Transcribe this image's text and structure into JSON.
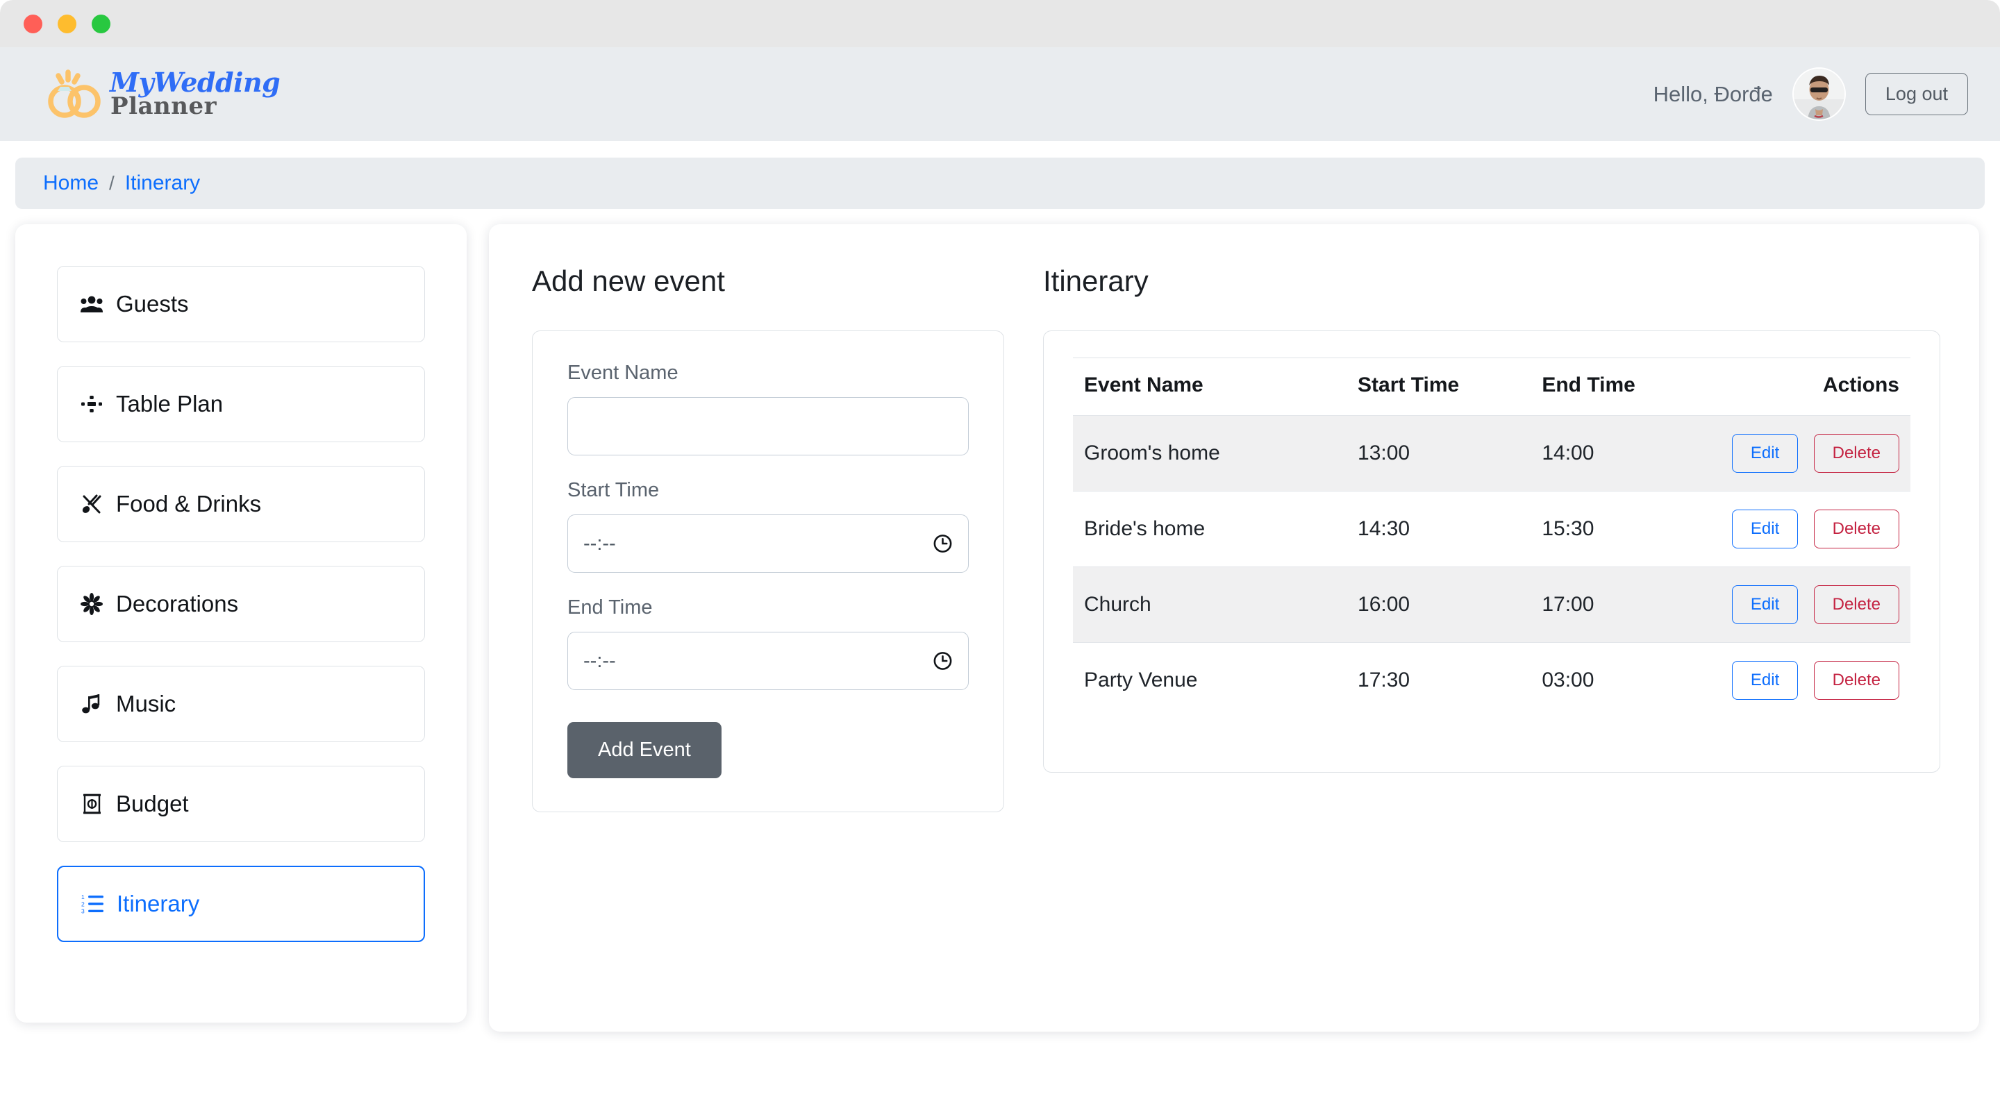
{
  "window_controls": {
    "close": "close",
    "minimize": "minimize",
    "maximize": "maximize"
  },
  "brand": {
    "line1": "MyWedding",
    "line2": "Planner",
    "icon": "wedding-rings-icon",
    "color_primary": "#2f6df6",
    "color_secondary": "#58595b",
    "ring_color": "#fcc36a"
  },
  "header": {
    "greeting": "Hello, Đorđe",
    "avatar_alt": "user-avatar",
    "logout_label": "Log out"
  },
  "breadcrumb": {
    "items": [
      {
        "label": "Home"
      },
      {
        "label": "Itinerary"
      }
    ],
    "separator": "/",
    "link_color": "#0d6efd"
  },
  "sidebar": {
    "items": [
      {
        "label": "Guests",
        "icon": "people-group-icon",
        "active": false
      },
      {
        "label": "Table Plan",
        "icon": "table-plan-icon",
        "active": false
      },
      {
        "label": "Food & Drinks",
        "icon": "fork-spoon-icon",
        "active": false
      },
      {
        "label": "Decorations",
        "icon": "flower-icon",
        "active": false
      },
      {
        "label": "Music",
        "icon": "music-note-icon",
        "active": false
      },
      {
        "label": "Budget",
        "icon": "money-receipt-icon",
        "active": false
      },
      {
        "label": "Itinerary",
        "icon": "ordered-list-icon",
        "active": true
      }
    ],
    "active_color": "#0d6efd"
  },
  "form": {
    "title": "Add new event",
    "event_name": {
      "label": "Event Name",
      "value": "",
      "placeholder": ""
    },
    "start_time": {
      "label": "Start Time",
      "value": "",
      "placeholder": "--:--",
      "icon": "clock-icon"
    },
    "end_time": {
      "label": "End Time",
      "value": "",
      "placeholder": "--:--",
      "icon": "clock-icon"
    },
    "submit_label": "Add Event",
    "submit_color": "#5a626b"
  },
  "itinerary": {
    "title": "Itinerary",
    "columns": [
      "Event Name",
      "Start Time",
      "End Time",
      "Actions"
    ],
    "rows": [
      {
        "name": "Groom's home",
        "start": "13:00",
        "end": "14:00",
        "edit": "Edit",
        "delete": "Delete",
        "striped": true
      },
      {
        "name": "Bride's home",
        "start": "14:30",
        "end": "15:30",
        "edit": "Edit",
        "delete": "Delete",
        "striped": false
      },
      {
        "name": "Church",
        "start": "16:00",
        "end": "17:00",
        "edit": "Edit",
        "delete": "Delete",
        "striped": true
      },
      {
        "name": "Party Venue",
        "start": "17:30",
        "end": "03:00",
        "edit": "Edit",
        "delete": "Delete",
        "striped": false
      }
    ],
    "edit_color": "#0d6efd",
    "delete_color": "#c42241",
    "stripe_color": "#f0f0f1"
  }
}
